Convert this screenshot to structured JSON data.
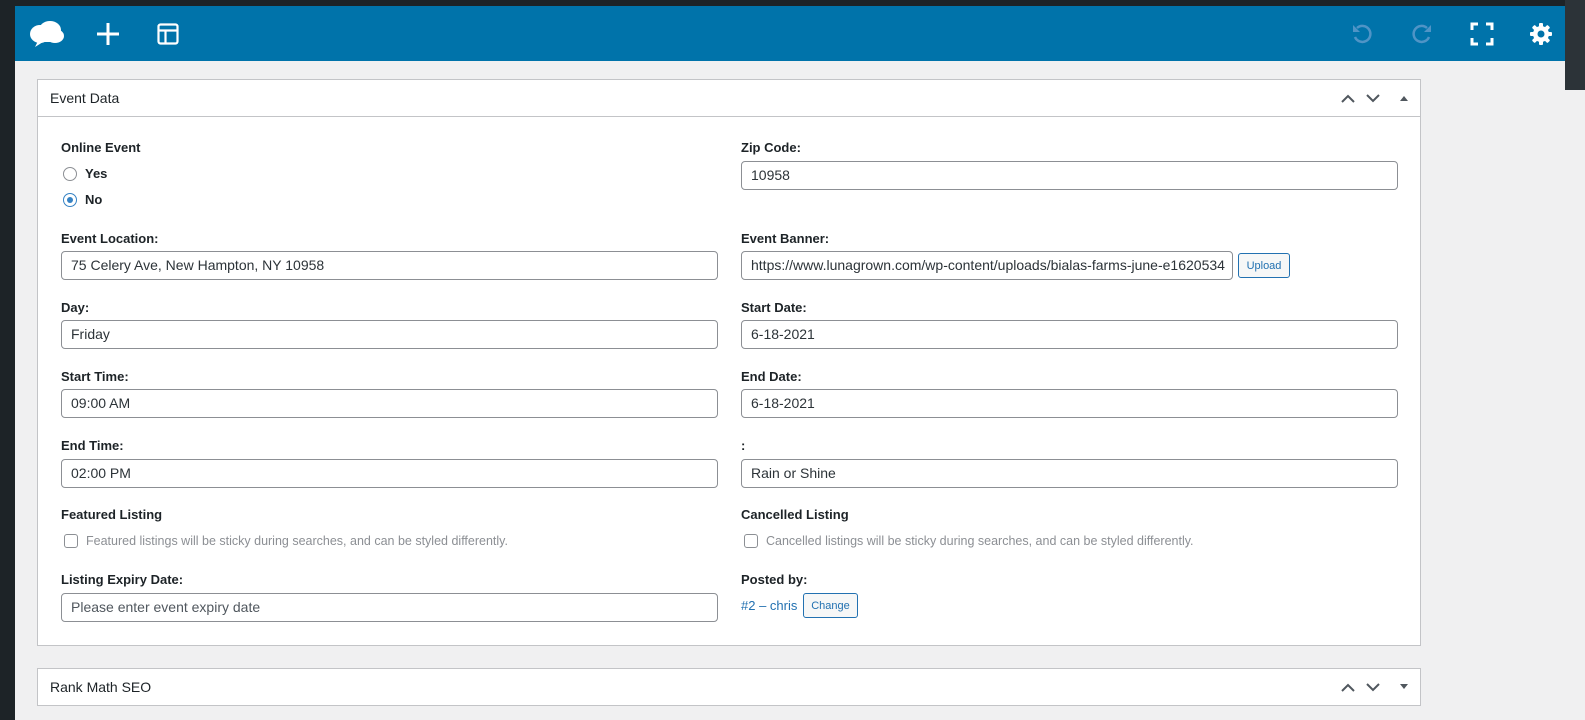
{
  "colors": {
    "toolbar": "#0073aa",
    "link": "#2271b1",
    "radio_selected": "#3582c4"
  },
  "toolbar": {
    "icons": [
      "cloud-logo-icon",
      "plus-icon",
      "layout-icon",
      "undo-icon",
      "redo-icon",
      "fullscreen-icon",
      "gear-icon"
    ]
  },
  "event_data": {
    "title": "Event Data",
    "online_event": {
      "label": "Online Event",
      "options": [
        {
          "label": "Yes",
          "selected": false
        },
        {
          "label": "No",
          "selected": true
        }
      ]
    },
    "zip_code": {
      "label": "Zip Code:",
      "value": "10958"
    },
    "event_location": {
      "label": "Event Location:",
      "value": "75 Celery Ave, New Hampton, NY 10958"
    },
    "event_banner": {
      "label": "Event Banner:",
      "value": "https://www.lunagrown.com/wp-content/uploads/bialas-farms-june-e1620534",
      "button": "Upload"
    },
    "day": {
      "label": "Day:",
      "value": "Friday"
    },
    "start_date": {
      "label": "Start Date:",
      "value": "6-18-2021"
    },
    "start_time": {
      "label": "Start Time:",
      "value": "09:00 AM"
    },
    "end_date": {
      "label": "End Date:",
      "value": "6-18-2021"
    },
    "end_time": {
      "label": "End Time:",
      "value": "02:00 PM"
    },
    "extra": {
      "label": ":",
      "value": "Rain or Shine"
    },
    "featured_listing": {
      "label": "Featured Listing",
      "checkbox_text": "Featured listings will be sticky during searches, and can be styled differently.",
      "checked": false
    },
    "cancelled_listing": {
      "label": "Cancelled Listing",
      "checkbox_text": "Cancelled listings will be sticky during searches, and can be styled differently.",
      "checked": false
    },
    "expiry": {
      "label": "Listing Expiry Date:",
      "placeholder": "Please enter event expiry date"
    },
    "posted_by": {
      "label": "Posted by:",
      "user": "#2 – chris",
      "button": "Change"
    }
  },
  "rank_math": {
    "title": "Rank Math SEO"
  }
}
